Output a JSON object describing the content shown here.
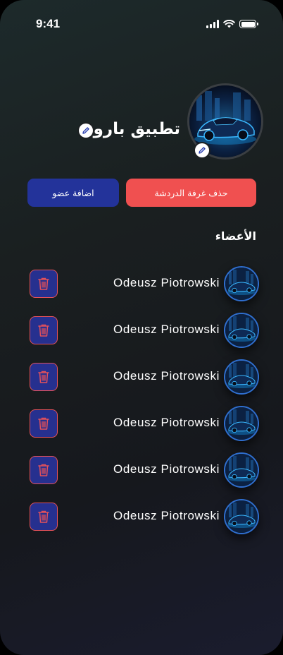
{
  "status_bar": {
    "time": "9:41"
  },
  "group": {
    "name": "تطبيق بارون",
    "edit_icon": "pencil-icon"
  },
  "actions": {
    "delete_room": "حذف غرفة الدردشة",
    "add_member": "اضافة عضو"
  },
  "members_section": {
    "title": "الأعضاء"
  },
  "members": [
    {
      "name": "Odeusz Piotrowski"
    },
    {
      "name": "Odeusz Piotrowski"
    },
    {
      "name": "Odeusz Piotrowski"
    },
    {
      "name": "Odeusz Piotrowski"
    },
    {
      "name": "Odeusz Piotrowski"
    },
    {
      "name": "Odeusz Piotrowski"
    }
  ],
  "colors": {
    "danger": "#f05050",
    "primary": "#23339a",
    "trash_border": "#e4515a"
  }
}
